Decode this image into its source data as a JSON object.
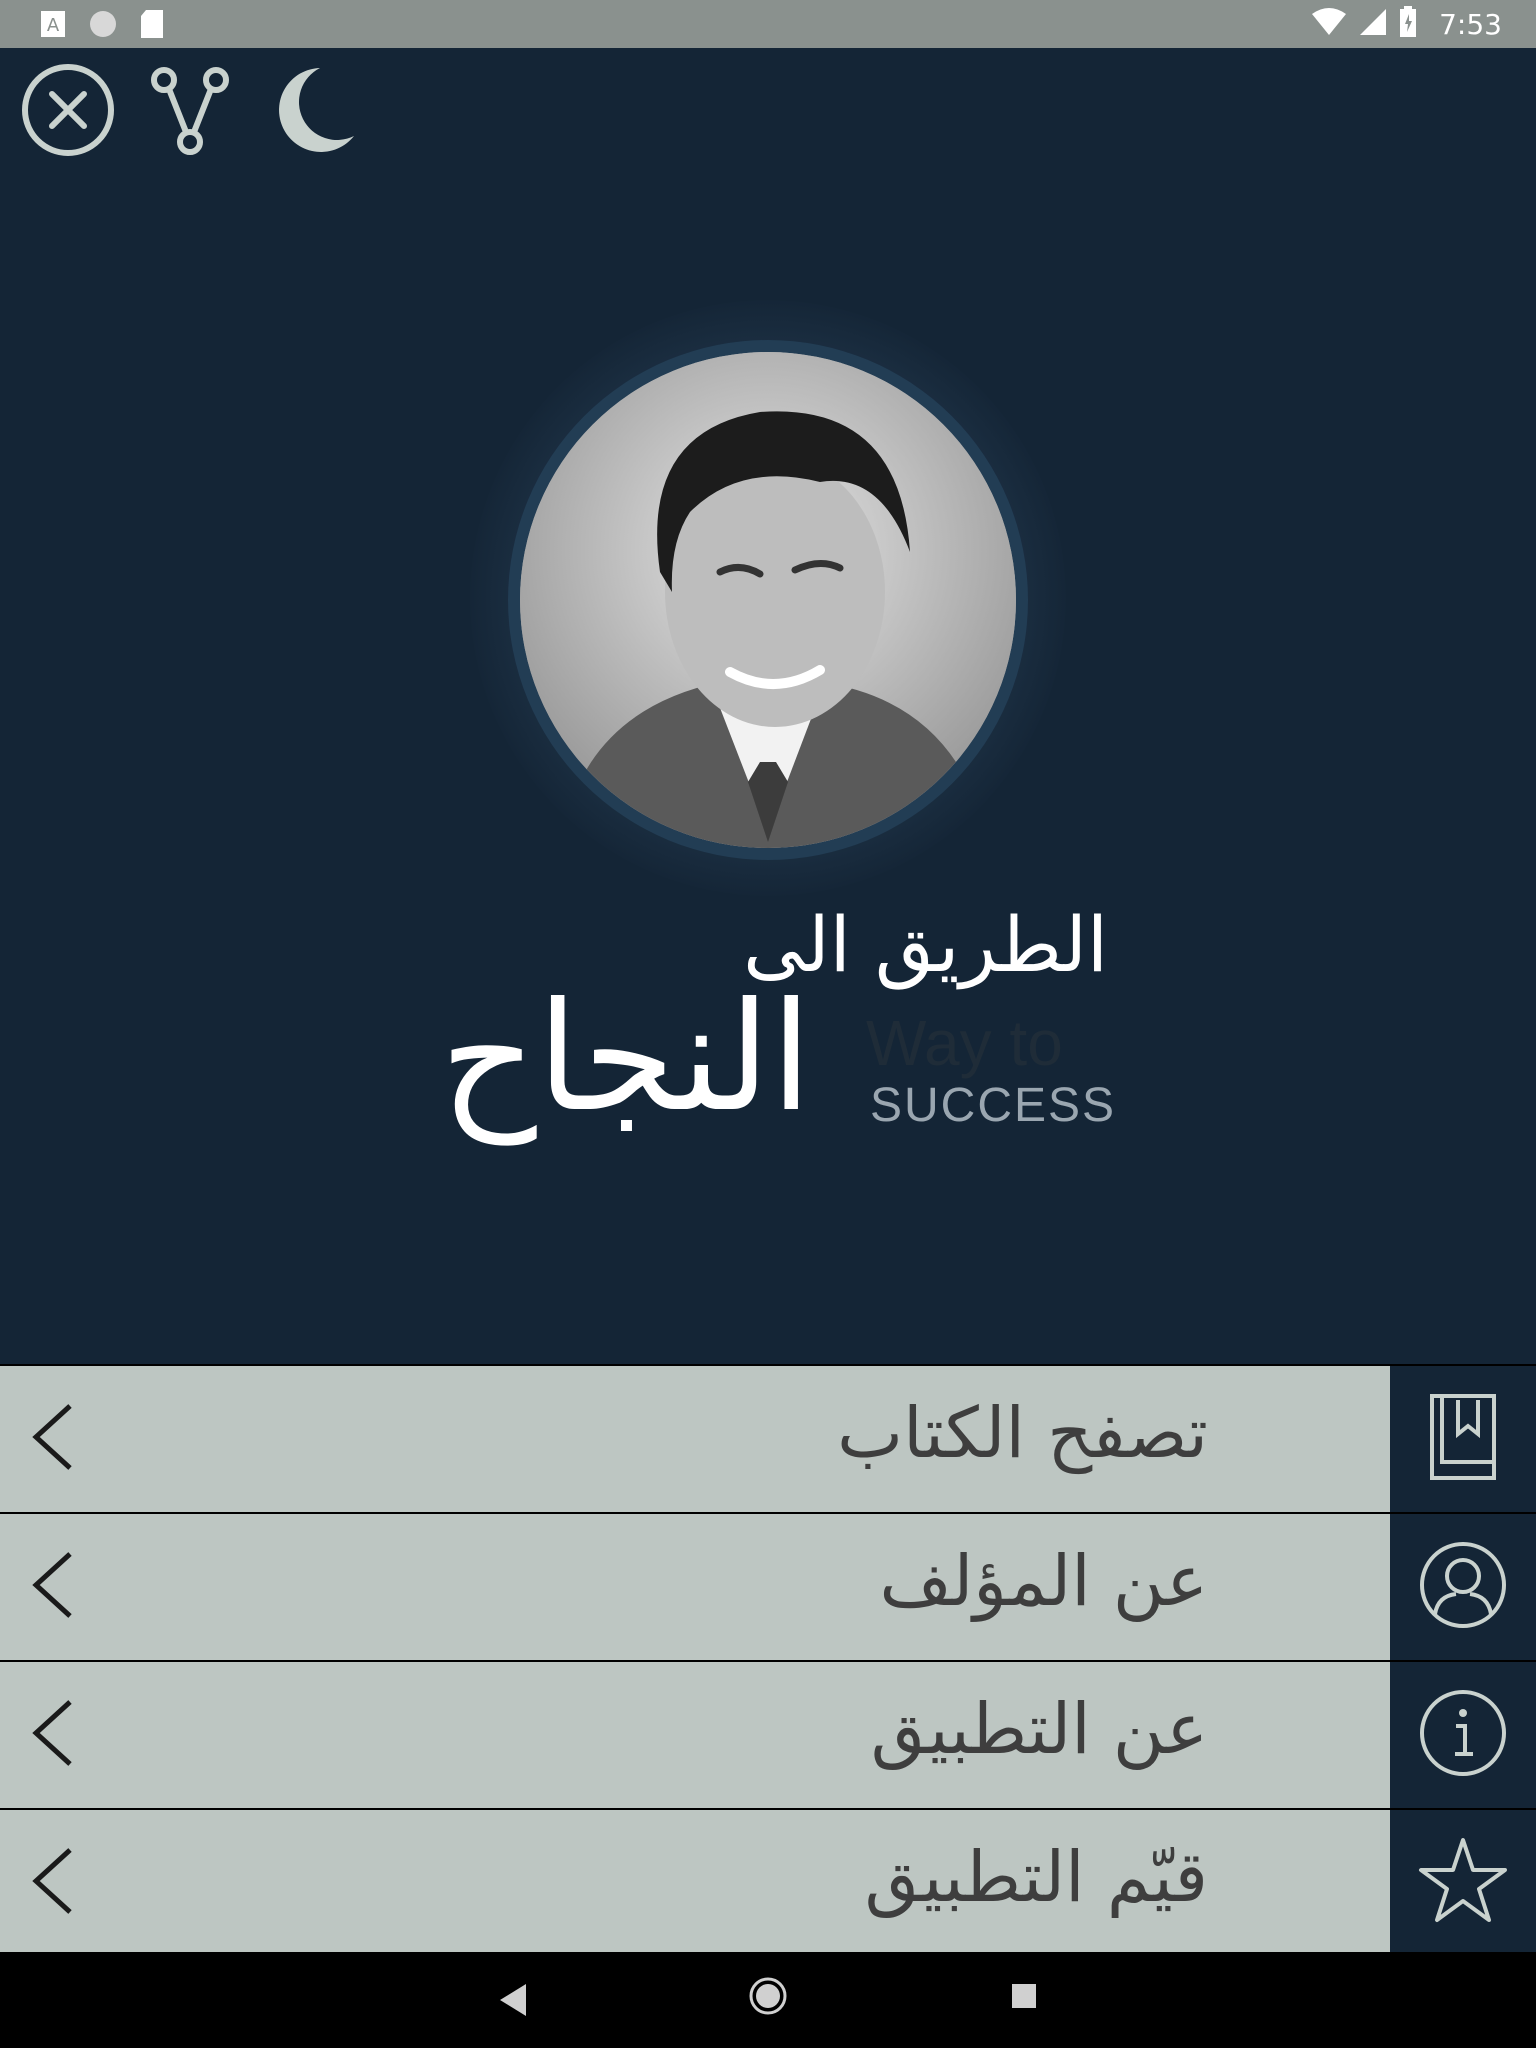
{
  "status_bar": {
    "time": "7:53",
    "left_icons": [
      "text-a-icon",
      "circle-icon",
      "sd-card-icon"
    ],
    "right_icons": [
      "wifi-icon",
      "signal-icon",
      "battery-icon"
    ]
  },
  "top_actions": {
    "items": [
      {
        "icon": "close-circle-icon"
      },
      {
        "icon": "share-icon"
      },
      {
        "icon": "moon-icon"
      }
    ]
  },
  "title": {
    "line1": "الطريق الى",
    "line2": "النجاح",
    "en_line1": "Way to",
    "en_line2": "SUCCESS"
  },
  "menu": {
    "items": [
      {
        "label": "تصفح الكتاب",
        "icon": "book-bookmark-icon"
      },
      {
        "label": "عن المؤلف",
        "icon": "user-circle-icon"
      },
      {
        "label": "عن التطبيق",
        "icon": "info-circle-icon"
      },
      {
        "label": "قيّم التطبيق",
        "icon": "star-icon"
      }
    ],
    "chevron_icon": "chevron-left-icon"
  },
  "nav_bar": {
    "icons": [
      "back-triangle-icon",
      "home-circle-icon",
      "recents-square-icon"
    ]
  },
  "colors": {
    "background": "#142536",
    "menu_background": "#bdc6c2",
    "status_bar": "#8a918e",
    "icon_stroke": "#c9d2ce"
  }
}
